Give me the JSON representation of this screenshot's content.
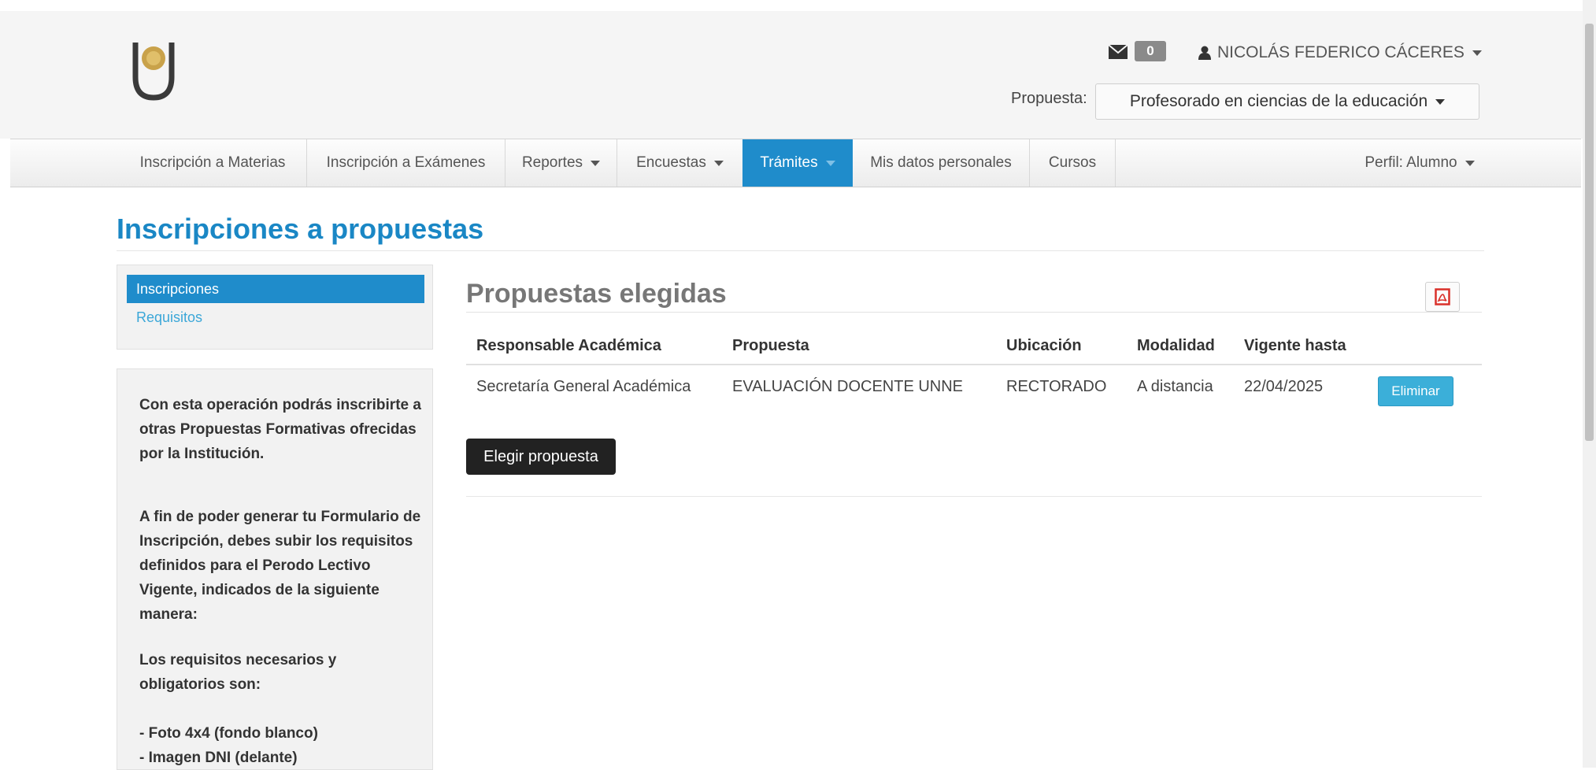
{
  "header": {
    "mail_count": "0",
    "user_name": "NICOLÁS FEDERICO CÁCERES",
    "propuesta_label": "Propuesta:",
    "propuesta_value": "Profesorado en ciencias de la educación"
  },
  "nav": {
    "items": [
      {
        "label": "Inscripción a Materias"
      },
      {
        "label": "Inscripción a Exámenes"
      },
      {
        "label": "Reportes"
      },
      {
        "label": "Encuestas"
      },
      {
        "label": "Trámites"
      },
      {
        "label": "Mis datos personales"
      },
      {
        "label": "Cursos"
      }
    ],
    "profile": "Perfil: Alumno"
  },
  "page": {
    "title": "Inscripciones a propuestas"
  },
  "sidebar": {
    "items": [
      {
        "label": "Inscripciones"
      },
      {
        "label": "Requisitos"
      }
    ],
    "info": [
      "Con esta operación podrás inscribirte a otras Propuestas Formativas ofrecidas por la Institución.",
      "A fin de poder generar tu Formulario de Inscripción, debes subir los requisitos definidos para el Perodo Lectivo Vigente, indicados de la siguiente manera:",
      "Los requisitos necesarios y obligatorios son:",
      "- Foto 4x4 (fondo blanco)",
      "- Imagen DNI (delante)"
    ]
  },
  "section": {
    "title": "Propuestas elegidas"
  },
  "table": {
    "headers": [
      "Responsable Académica",
      "Propuesta",
      "Ubicación",
      "Modalidad",
      "Vigente hasta"
    ],
    "rows": [
      [
        "Secretaría General Académica",
        "EVALUACIÓN DOCENTE UNNE",
        "RECTORADO",
        "A distancia",
        "22/04/2025"
      ]
    ],
    "delete_label": "Eliminar"
  },
  "actions": {
    "choose_label": "Elegir propuesta"
  },
  "colors": {
    "accent": "#1f8ccb",
    "title": "#1a87c5",
    "info_button": "#3bafd9",
    "pdf_red": "#d9302a"
  },
  "icons": [
    "university-logo-icon",
    "envelope-icon",
    "user-icon",
    "pdf-icon"
  ]
}
